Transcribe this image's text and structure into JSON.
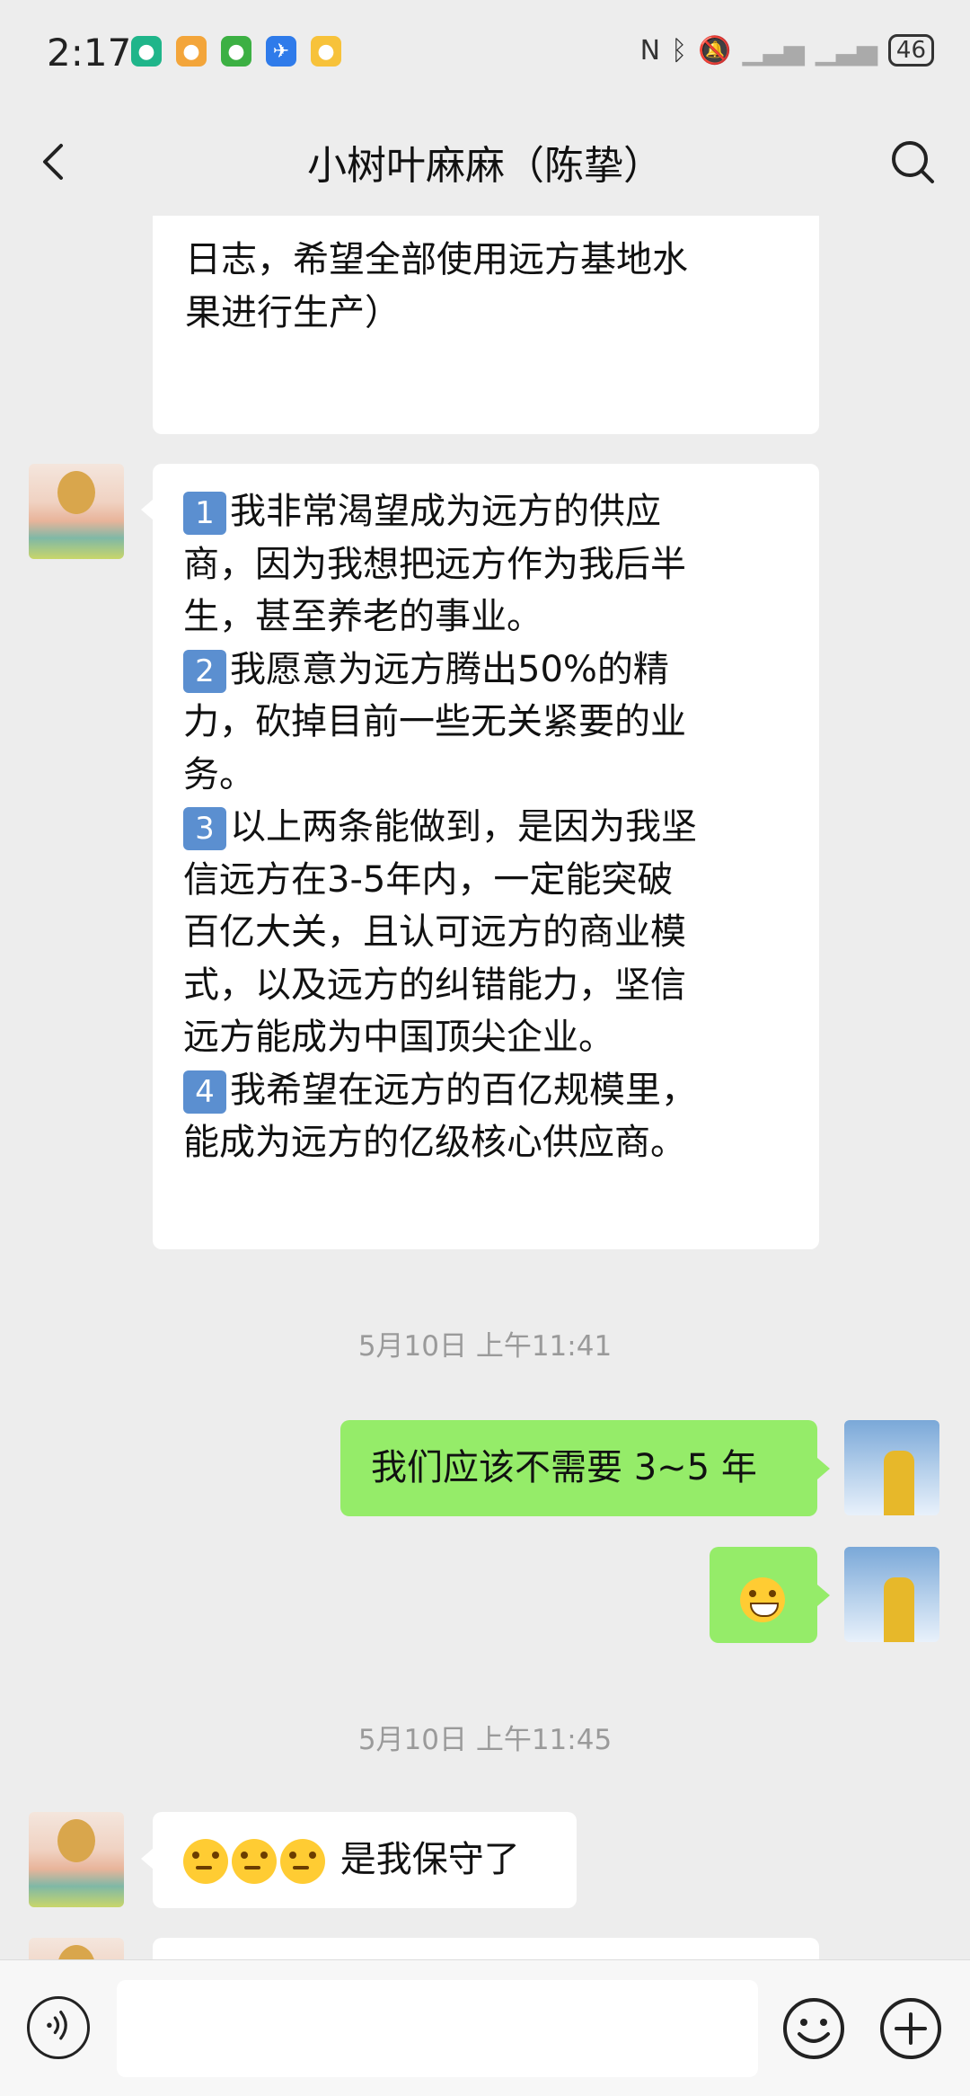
{
  "status_bar": {
    "time": "2:17",
    "battery": "46",
    "icons": [
      "nfc-icon",
      "bluetooth-icon",
      "mute-icon",
      "signal-x-icon",
      "signal-x-icon"
    ]
  },
  "header": {
    "title": "小树叶麻麻（陈挚）"
  },
  "messages": {
    "m0_text": "日志，希望全部使用远方基地水\n果进行生产）",
    "m1_lines": [
      "我非常渴望成为远方的供应",
      "商，因为我想把远方作为我后半",
      "生，甚至养老的事业。",
      "我愿意为远方腾出50%的精",
      "力，砍掉目前一些无关紧要的业",
      "务。",
      "以上两条能做到，是因为我坚",
      "信远方在3-5年内，一定能突破",
      "百亿大关，且认可远方的商业模",
      "式，以及远方的纠错能力，坚信",
      "远方能成为中国顶尖企业。",
      "我希望在远方的百亿规模里，",
      "能成为远方的亿级核心供应商。"
    ],
    "badges": [
      "1",
      "2",
      "3",
      "4"
    ],
    "ts1": "5月10日 上午11:41",
    "m2_text": "我们应该不需要 3~5 年",
    "ts2": "5月10日 上午11:45",
    "m4_text": "是我保守了"
  },
  "input": {
    "placeholder": ""
  },
  "colors": {
    "background": "#ededed",
    "my_bubble": "#95ec69",
    "their_bubble": "#ffffff"
  }
}
